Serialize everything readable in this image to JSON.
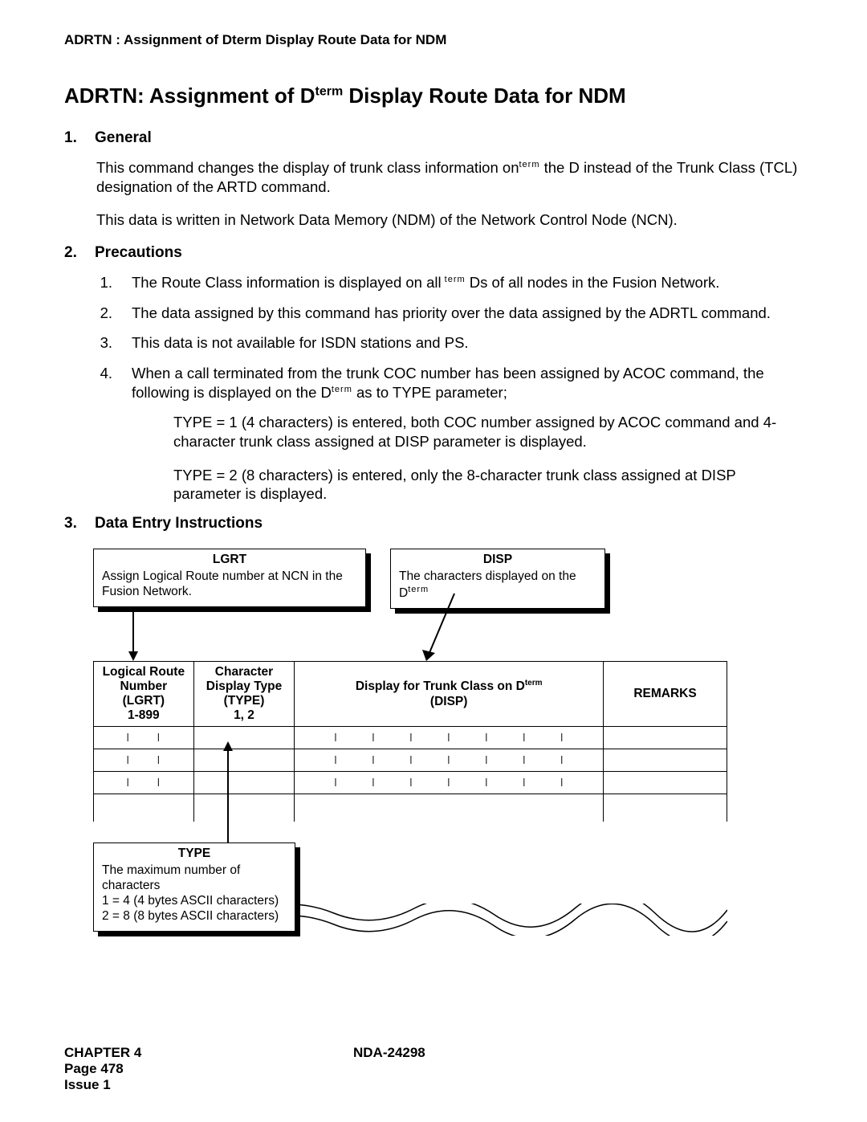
{
  "headerLine": "ADRTN : Assignment of Dterm Display Route Data for NDM",
  "title_pre": "ADRTN: Assignment of D",
  "title_sup": "term",
  "title_post": " Display Route Data for NDM",
  "sec1_num": "1.",
  "sec1_title": "General",
  "gen_p1a": "This command changes the display of trunk class information on",
  "gen_p1_sup": "term",
  "gen_p1b": " the D instead of the Trunk Class (TCL) designation of the ARTD command.",
  "gen_p2": "This data is written in Network Data Memory (NDM) of the Network Control Node (NCN).",
  "sec2_num": "2.",
  "sec2_title": "Precautions",
  "prec1_num": "1.",
  "prec1a": "The Route Class information is displayed on all",
  "prec1_sup": " term",
  "prec1b": " Ds of all nodes in the Fusion Network.",
  "prec2_num": "2.",
  "prec2": "The data assigned by this command has priority over the data assigned by the ADRTL command.",
  "prec3_num": "3.",
  "prec3": "This data is not available for ISDN stations and PS.",
  "prec4_num": "4.",
  "prec4a": "When a call terminated from the trunk COC number has been assigned by ACOC command, the following is displayed on the D",
  "prec4_sup": "term",
  "prec4b": " as to TYPE  parameter;",
  "prec4_sub1": "TYPE = 1 (4 characters) is entered, both COC number assigned by ACOC command and 4-character trunk class assigned at DISP  parameter is displayed.",
  "prec4_sub2": "TYPE = 2 (8 characters) is entered, only the 8-character trunk class assigned at DISP parameter is displayed.",
  "sec3_num": "3.",
  "sec3_title": "Data Entry Instructions",
  "callout_lgrt_title": "LGRT",
  "callout_lgrt_body": "Assign Logical Route number at NCN in the Fusion Network.",
  "callout_disp_title": "DISP",
  "callout_disp_body_a": "The characters displayed on the D",
  "callout_disp_body_sup": "term",
  "callout_type_title": "TYPE",
  "callout_type_l1": "The maximum number of characters",
  "callout_type_l2": "1 = 4 (4 bytes ASCII characters)",
  "callout_type_l3": "2 = 8 (8 bytes ASCII characters)",
  "th1_l1": "Logical Route",
  "th1_l2": "Number",
  "th1_l3": "(LGRT)",
  "th1_l4": "1-899",
  "th2_l1": "Character",
  "th2_l2": "Display Type",
  "th2_l3": "(TYPE)",
  "th2_l4": "1, 2",
  "th3_l1a": "Display for Trunk Class on D",
  "th3_l1_sup": "term",
  "th3_l2": "(DISP)",
  "th4": "REMARKS",
  "footer_chapter": "CHAPTER 4",
  "footer_page": "Page 478",
  "footer_issue": "Issue 1",
  "footer_doc": "NDA-24298"
}
